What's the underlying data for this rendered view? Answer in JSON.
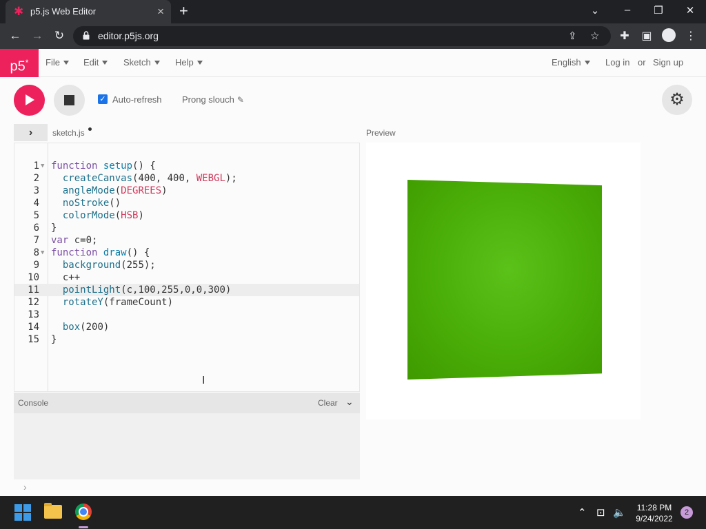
{
  "browser": {
    "tab_title": "p5.js Web Editor",
    "url": "editor.p5js.org"
  },
  "navbar": {
    "logo": "p5",
    "logo_mark": "*",
    "menus": [
      "File",
      "Edit",
      "Sketch",
      "Help"
    ],
    "language": "English",
    "login": "Log in",
    "or": "or",
    "signup": "Sign up"
  },
  "toolbar": {
    "auto_refresh_label": "Auto-refresh",
    "auto_refresh_checked": true,
    "sketch_name": "Prong slouch"
  },
  "editor": {
    "filename": "sketch.js",
    "active_line": 11,
    "lines": [
      "function setup() {",
      "  createCanvas(400, 400, WEBGL);",
      "  angleMode(DEGREES)",
      "  noStroke()",
      "  colorMode(HSB)",
      "}",
      "var c=0;",
      "function draw() {",
      "  background(255);",
      "  c++",
      "  pointLight(c,100,255,0,0,300)",
      "  rotateY(frameCount)",
      "",
      "  box(200)",
      "}"
    ]
  },
  "console": {
    "title": "Console",
    "clear": "Clear"
  },
  "preview": {
    "label": "Preview",
    "box_color": "#48ab06"
  },
  "taskbar": {
    "time": "11:28 PM",
    "date": "9/24/2022",
    "notifications": "2"
  },
  "colors": {
    "accent": "#ed225d"
  }
}
